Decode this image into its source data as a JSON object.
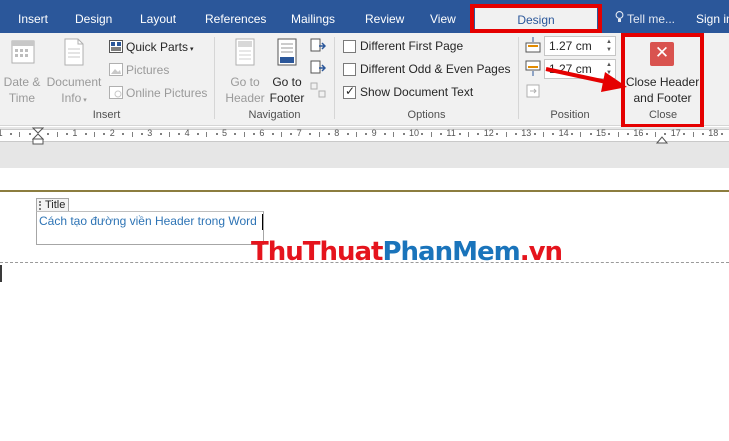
{
  "tabs": [
    "Insert",
    "Design",
    "Layout",
    "References",
    "Mailings",
    "Review",
    "View",
    "Design"
  ],
  "tell_me": "Tell me...",
  "sign_in": "Sign in",
  "ribbon": {
    "date_time": [
      "Date &",
      "Time"
    ],
    "document_info": [
      "Document",
      "Info"
    ],
    "quick_parts": "Quick Parts",
    "pictures": "Pictures",
    "online_pictures": "Online Pictures",
    "insert_group": "Insert",
    "go_to_header": [
      "Go to",
      "Header"
    ],
    "go_to_footer": [
      "Go to",
      "Footer"
    ],
    "navigation_group": "Navigation",
    "different_first_page": "Different First Page",
    "different_odd_even": "Different Odd & Even Pages",
    "show_document_text": "Show Document Text",
    "show_document_text_checked": true,
    "options_group": "Options",
    "header_position": "1.27 cm",
    "footer_position": "1.27 cm",
    "position_group": "Position",
    "close_header_footer": [
      "Close Header",
      "and Footer"
    ],
    "close_group": "Close"
  },
  "ruler": {
    "numbers": [
      "1",
      "2",
      "1",
      "2",
      "3",
      "4",
      "5",
      "6",
      "7",
      "8",
      "9",
      "10",
      "11",
      "12",
      "13",
      "14",
      "15",
      "16",
      "17",
      "18"
    ]
  },
  "document": {
    "title_tag": "Title",
    "title_text": "Cách tạo đường viền Header trong Word"
  },
  "watermark": {
    "part1": "ThuThuat",
    "part2": "PhanMem",
    "part3": ".vn"
  },
  "colors": {
    "tab_bar": "#2b579a",
    "ribbon_bg": "#f1f1f1",
    "annotation_red": "#e50000",
    "title_text": "#2e74b5",
    "watermark_red": "#e5141d",
    "watermark_blue": "#1a74bb"
  }
}
